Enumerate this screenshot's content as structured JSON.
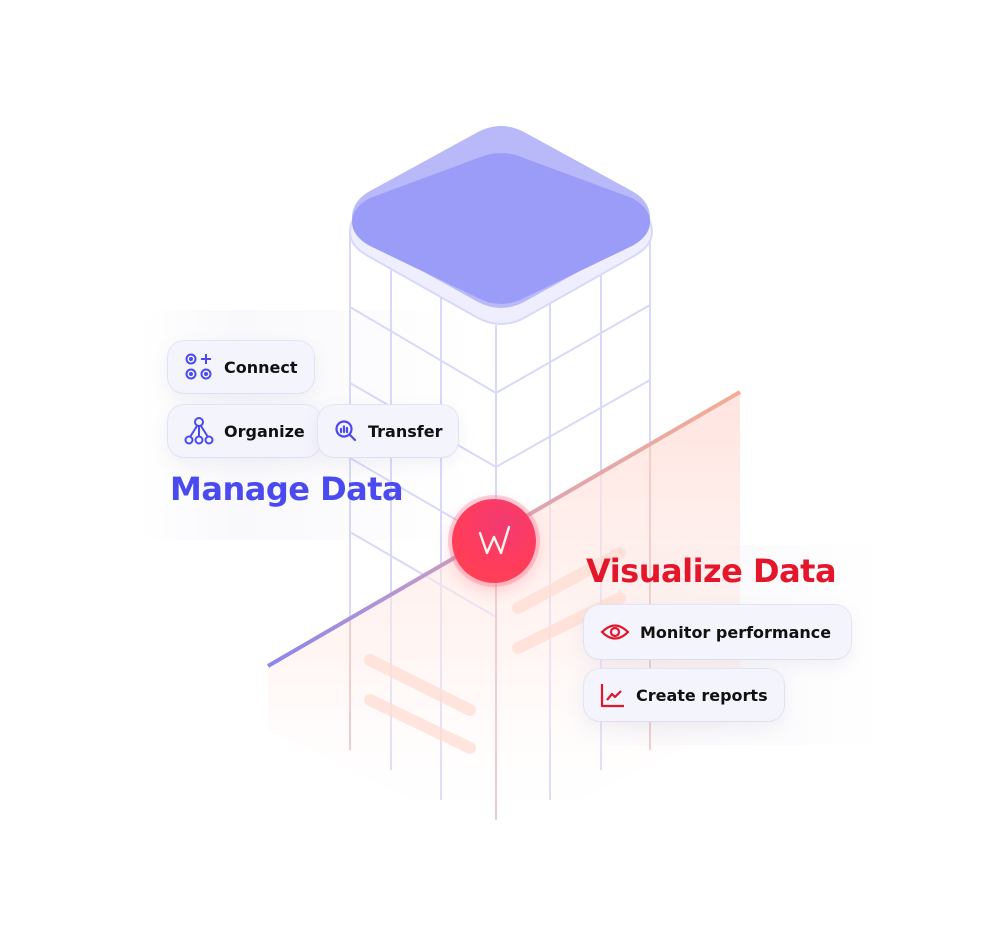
{
  "colors": {
    "manage_accent": "#4a4af0",
    "visualize_accent": "#e3162b",
    "tower_top": "#9b9cf7",
    "grid_line": "#d8d8fb",
    "logo_red": "#ff3c5c"
  },
  "manage": {
    "title": "Manage Data",
    "items": [
      {
        "label": "Connect",
        "icon": "connect-icon"
      },
      {
        "label": "Organize",
        "icon": "organize-icon"
      },
      {
        "label": "Transfer",
        "icon": "transfer-icon"
      }
    ]
  },
  "visualize": {
    "title": "Visualize Data",
    "items": [
      {
        "label": "Monitor performance",
        "icon": "eye-icon"
      },
      {
        "label": "Create reports",
        "icon": "line-chart-icon"
      }
    ]
  },
  "logo": {
    "glyph": "W",
    "icon": "brand-logo-icon"
  }
}
